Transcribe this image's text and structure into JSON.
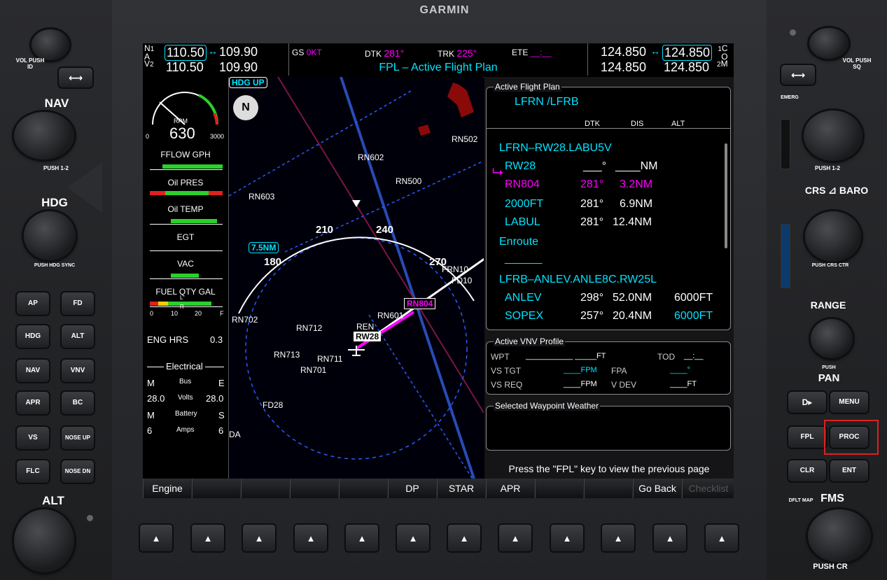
{
  "brand": "GARMIN",
  "left_panel": {
    "vol_label": "VOL",
    "vol_sub": "PUSH ID",
    "nav_label": "NAV",
    "nav_push": "PUSH 1-2",
    "hdg_label": "HDG",
    "hdg_push": "PUSH HDG SYNC",
    "alt_label": "ALT",
    "buttons": [
      {
        "label": "AP"
      },
      {
        "label": "FD"
      },
      {
        "label": "HDG"
      },
      {
        "label": "ALT"
      },
      {
        "label": "NAV"
      },
      {
        "label": "VNV"
      },
      {
        "label": "APR"
      },
      {
        "label": "BC"
      },
      {
        "label": "VS"
      },
      {
        "label": "NOSE UP"
      },
      {
        "label": "FLC"
      },
      {
        "label": "NOSE DN"
      }
    ]
  },
  "right_panel": {
    "vol_label": "VOL",
    "vol_sub": "PUSH SQ",
    "emerg": "EMERG",
    "com_push": "PUSH 1-2",
    "crs_label": "CRS",
    "baro_label": "BARO",
    "crs_push": "PUSH CRS CTR",
    "range_label": "RANGE",
    "pan_push": "PUSH",
    "pan_label": "PAN",
    "fms_label": "FMS",
    "dflt_map": "DFLT MAP",
    "push_cr": "PUSH CR",
    "buttons": {
      "direct": "D▸",
      "menu": "MENU",
      "fpl": "FPL",
      "proc": "PROC",
      "clr": "CLR",
      "ent": "ENT"
    }
  },
  "nav": {
    "n1_active": "110.50",
    "n1_standby": "109.90",
    "n2_active": "110.50",
    "n2_standby": "109.90",
    "label_n": "N",
    "label_a": "A",
    "label_v": "V",
    "idx1": "1",
    "idx2": "2"
  },
  "com": {
    "c1_active": "124.850",
    "c1_standby": "124.850",
    "c2_active": "124.850",
    "c2_standby": "124.850",
    "label_c": "C",
    "label_o": "O",
    "label_m": "M",
    "idx1": "1",
    "idx2": "2"
  },
  "status": {
    "gs_label": "GS",
    "gs_value": "0KT",
    "dtk_label": "DTK",
    "dtk_value": "281°",
    "trk_label": "TRK",
    "trk_value": "225°",
    "ete_label": "ETE",
    "ete_value": "__:__",
    "page_title": "FPL – Active Flight Plan"
  },
  "engine": {
    "rpm_label": "RPM",
    "rpm_value": "630",
    "rpm_min": "0",
    "rpm_max": "3000",
    "fflow_label": "FFLOW GPH",
    "oilpres_label": "Oil PRES",
    "oiltemp_label": "Oil TEMP",
    "egt_label": "EGT",
    "vac_label": "VAC",
    "fuel_label": "FUEL QTY GAL",
    "fuel_ticks": [
      "0",
      "10",
      "20",
      "F"
    ],
    "fuel_l": "L",
    "fuel_r": "R",
    "eng_hrs_label": "ENG HRS",
    "eng_hrs_value": "0.3",
    "electrical_label": "Electrical",
    "bus_m": "M",
    "bus_label": "Bus",
    "bus_e": "E",
    "volts_left": "28.0",
    "volts_label": "Volts",
    "volts_right": "28.0",
    "batt_m": "M",
    "batt_label": "Battery",
    "batt_s": "S",
    "amps_left": "6",
    "amps_label": "Amps",
    "amps_right": "6"
  },
  "map": {
    "orientation": "HDG UP",
    "north": "N",
    "range": "7.5NM",
    "compass": [
      "180",
      "210",
      "240",
      "270"
    ],
    "waypoints": [
      "RN502",
      "RN602",
      "RN500",
      "RN603",
      "FRN10",
      "FD10",
      "RN702",
      "RN712",
      "REN",
      "RN601",
      "RN713",
      "RN711",
      "RN701",
      "FD28",
      "DA"
    ],
    "rw_label": "RW28",
    "active_wpt": "RN804"
  },
  "fpl": {
    "title": "Active Flight Plan",
    "route": "LFRN /LFRB",
    "hdr_dtk": "DTK",
    "hdr_dis": "DIS",
    "hdr_alt": "ALT",
    "rows": [
      {
        "name": "LFRN–RW28.LABU5V",
        "dtk": "",
        "dis": "",
        "alt": "",
        "cls": "cyan"
      },
      {
        "name": "RW28",
        "dtk": "___°",
        "dis": "____NM",
        "alt": "",
        "cls": "cyan"
      },
      {
        "name": "RN804",
        "dtk": "281°",
        "dis": "3.2NM",
        "alt": "",
        "cls": "mag"
      },
      {
        "name": "2000FT",
        "dtk": "281°",
        "dis": "6.9NM",
        "alt": "",
        "cls": "cyan"
      },
      {
        "name": "LABUL",
        "dtk": "281°",
        "dis": "12.4NM",
        "alt": "",
        "cls": "cyan"
      },
      {
        "name": "Enroute",
        "dtk": "",
        "dis": "",
        "alt": "",
        "cls": "cyan"
      },
      {
        "name": "______",
        "dtk": "",
        "dis": "",
        "alt": "",
        "cls": "cyan"
      },
      {
        "name": "LFRB–ANLEV.ANLE8C.RW25L",
        "dtk": "",
        "dis": "",
        "alt": "",
        "cls": "cyan"
      },
      {
        "name": "ANLEV",
        "dtk": "298°",
        "dis": "52.0NM",
        "alt": "6000FT",
        "cls": "cyan"
      },
      {
        "name": "SOPEX",
        "dtk": "257°",
        "dis": "20.4NM",
        "alt": "6000FT",
        "cls": "cyan"
      }
    ]
  },
  "vnv": {
    "title": "Active VNV Profile",
    "wpt_label": "WPT",
    "wpt_value": "___________ _____FT",
    "tod_label": "TOD",
    "tod_value": "__:__",
    "vstgt_label": "VS TGT",
    "vstgt_value": "____FPM",
    "fpa_label": "FPA",
    "fpa_value": "____°",
    "vsreq_label": "VS REQ",
    "vsreq_value": "____FPM",
    "vdev_label": "V DEV",
    "vdev_value": "____FT"
  },
  "weather": {
    "title": "Selected Waypoint Weather"
  },
  "hint": "Press the \"FPL\" key to view the previous page",
  "softkeys": [
    "Engine",
    "",
    "",
    "",
    "",
    "DP",
    "STAR",
    "APR",
    "",
    "",
    "Go Back",
    "Checklist"
  ],
  "colors": {
    "cyan": "#00e4ff",
    "magenta": "#ff00ff",
    "green": "#2ad12a",
    "highlight": "#e02020"
  }
}
